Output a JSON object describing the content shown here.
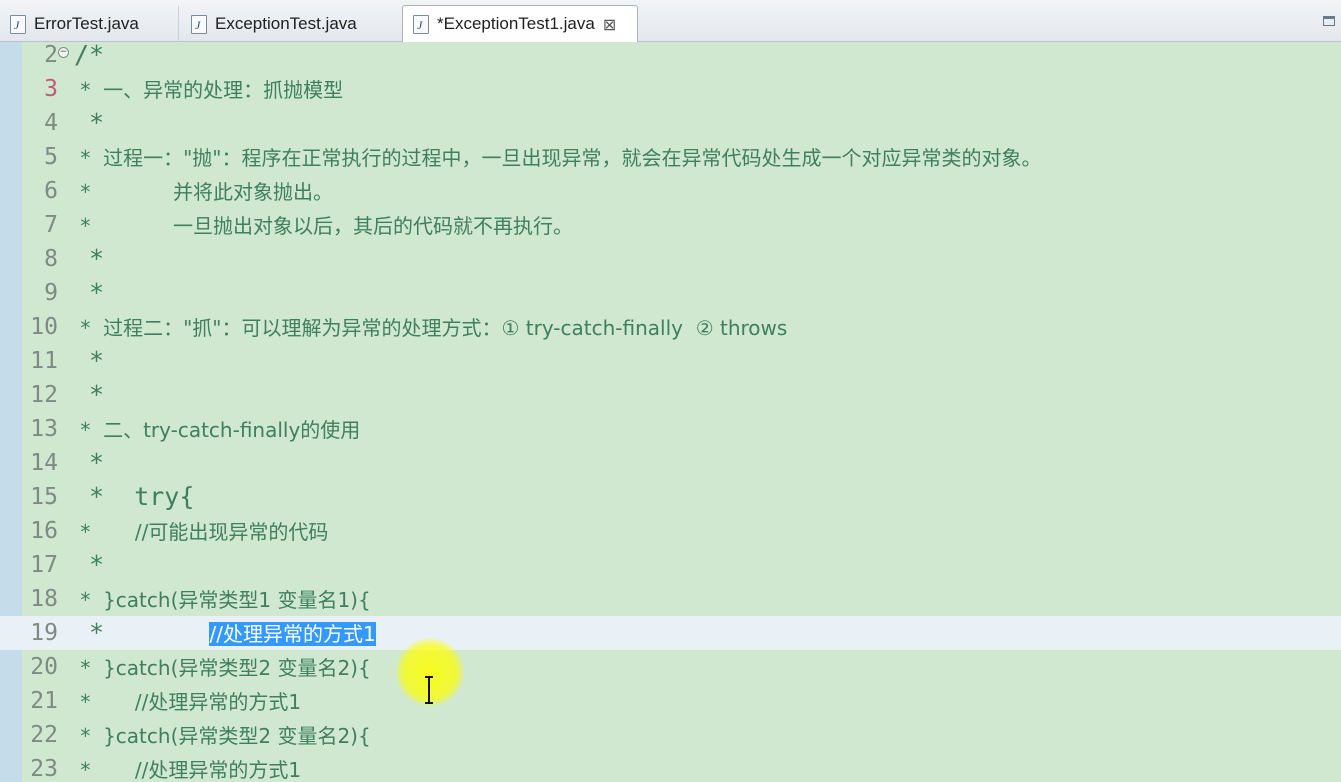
{
  "tabs": [
    {
      "label": "ErrorTest.java",
      "active": false
    },
    {
      "label": "ExceptionTest.java",
      "active": false
    },
    {
      "label": "*ExceptionTest1.java",
      "active": true,
      "close_glyph": "⊠"
    }
  ],
  "editor": {
    "lines": [
      {
        "num": "2",
        "code": "/*"
      },
      {
        "num": "3",
        "code": " *  一、异常的处理：抓抛模型"
      },
      {
        "num": "4",
        "code": " *"
      },
      {
        "num": "5",
        "code": " *  过程一：\"抛\"：程序在正常执行的过程中，一旦出现异常，就会在异常代码处生成一个对应异常类的对象。"
      },
      {
        "num": "6",
        "code": " *             并将此对象抛出。"
      },
      {
        "num": "7",
        "code": " *             一旦抛出对象以后，其后的代码就不再执行。"
      },
      {
        "num": "8",
        "code": " *"
      },
      {
        "num": "9",
        "code": " *"
      },
      {
        "num": "10",
        "code": " *  过程二：\"抓\"：可以理解为异常的处理方式：① try-catch-finally  ② throws"
      },
      {
        "num": "11",
        "code": " *"
      },
      {
        "num": "12",
        "code": " *"
      },
      {
        "num": "13",
        "code": " *  二、try-catch-finally的使用"
      },
      {
        "num": "14",
        "code": " *"
      },
      {
        "num": "15",
        "code": " *  try{"
      },
      {
        "num": "16",
        "code": " *       //可能出现异常的代码"
      },
      {
        "num": "17",
        "code": " *"
      },
      {
        "num": "18",
        "code": " *  }catch(异常类型1 变量名1){"
      },
      {
        "num": "19",
        "code_before": " *       ",
        "selected": "//处理异常的方式1",
        "code_after": "",
        "current": true
      },
      {
        "num": "20",
        "code": " *  }catch(异常类型2 变量名2){"
      },
      {
        "num": "21",
        "code": " *       //处理异常的方式1"
      },
      {
        "num": "22",
        "code": " *  }catch(异常类型2 变量名2){"
      },
      {
        "num": "23",
        "code": " *       //处理异常的方式1"
      }
    ]
  },
  "colors": {
    "editor_background": "#cfe8cf",
    "comment_text": "#3f7f5f",
    "selection": "#3399ff",
    "current_line": "#e9f1f6",
    "line_number": "#7f8a84"
  },
  "icons": {
    "tab_file_icon": "java-file-icon",
    "tab_close_icon": "close-icon",
    "maximize_icon": "maximize-icon"
  }
}
